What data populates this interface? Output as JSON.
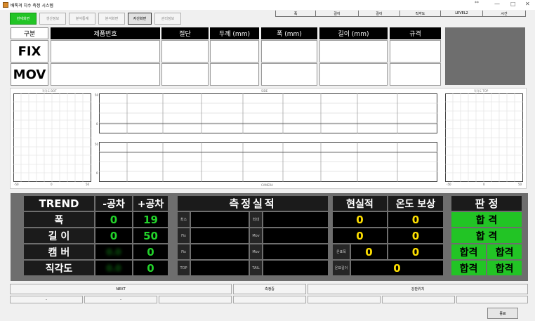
{
  "window": {
    "title": "배톡격 치수 측정 시스템",
    "indicator": "**",
    "minimize": "—",
    "maximize": "□",
    "close": "✕"
  },
  "toolbar": {
    "buttons": [
      "현재화면",
      "생산정보",
      "분석통계",
      "분석화면",
      "자산화면",
      "관리정보"
    ]
  },
  "header_info": {
    "columns": [
      "폭",
      "길이",
      "길이",
      "직각도",
      "LEVEL2",
      "시간"
    ]
  },
  "product_table": {
    "label_header": "구분",
    "columns": [
      "제품번호",
      "절단",
      "두께 (mm)",
      "폭 (mm)",
      "길이 (mm)",
      "규격"
    ],
    "rows": [
      "FIX",
      "MOV"
    ]
  },
  "charts": {
    "left_title": "직각도 BOT",
    "center_title": "SIDE",
    "right_title": "직각도 TOP",
    "bottom_label": "CAMERA",
    "left_ticks": [
      "-50",
      "0",
      "50"
    ],
    "right_ticks": [
      "-50",
      "0",
      "50"
    ],
    "side_top_ticks": [
      "50",
      "0"
    ],
    "side_bottom_ticks": [
      "50",
      "0"
    ]
  },
  "trend": {
    "headers": [
      "TREND",
      "-공차",
      "+공차"
    ],
    "rows": [
      {
        "label": "폭",
        "minus": "0",
        "plus": "19"
      },
      {
        "label": "길 이",
        "minus": "0",
        "plus": "50"
      },
      {
        "label": "캠 버",
        "minus": "0.0",
        "plus": "0"
      },
      {
        "label": "직각도",
        "minus": "0.0",
        "plus": "0"
      }
    ]
  },
  "measurement": {
    "title": "측정실적",
    "left_labels": [
      "최소",
      "Fix",
      "Fix",
      "TOP"
    ],
    "right_labels": [
      "최대",
      "Mov",
      "Mov",
      "TAIL"
    ]
  },
  "actual": {
    "headers": [
      "현실적",
      "온도 보상"
    ],
    "rows": [
      {
        "label": "",
        "a": "0",
        "b": "0"
      },
      {
        "label": "",
        "a": "0",
        "b": "0"
      },
      {
        "label": "온표폭",
        "a": "0",
        "b": "0"
      },
      {
        "label": "온표길이",
        "a": "0",
        "b": ""
      }
    ]
  },
  "judgement": {
    "title": "판 정",
    "pass_full": [
      "합 격",
      "합 격"
    ],
    "pass_half": [
      "합격",
      "합격",
      "합격",
      "합격"
    ]
  },
  "status": {
    "next": "NEXT",
    "measuring": "측정중",
    "position": "강판위치",
    "sub": [
      "-",
      "-",
      "",
      "",
      "",
      "",
      ""
    ],
    "close_button": "종료"
  },
  "colors": {
    "green": "#22c425",
    "yellow": "#ffe000",
    "panel": "#6e6e6e"
  }
}
